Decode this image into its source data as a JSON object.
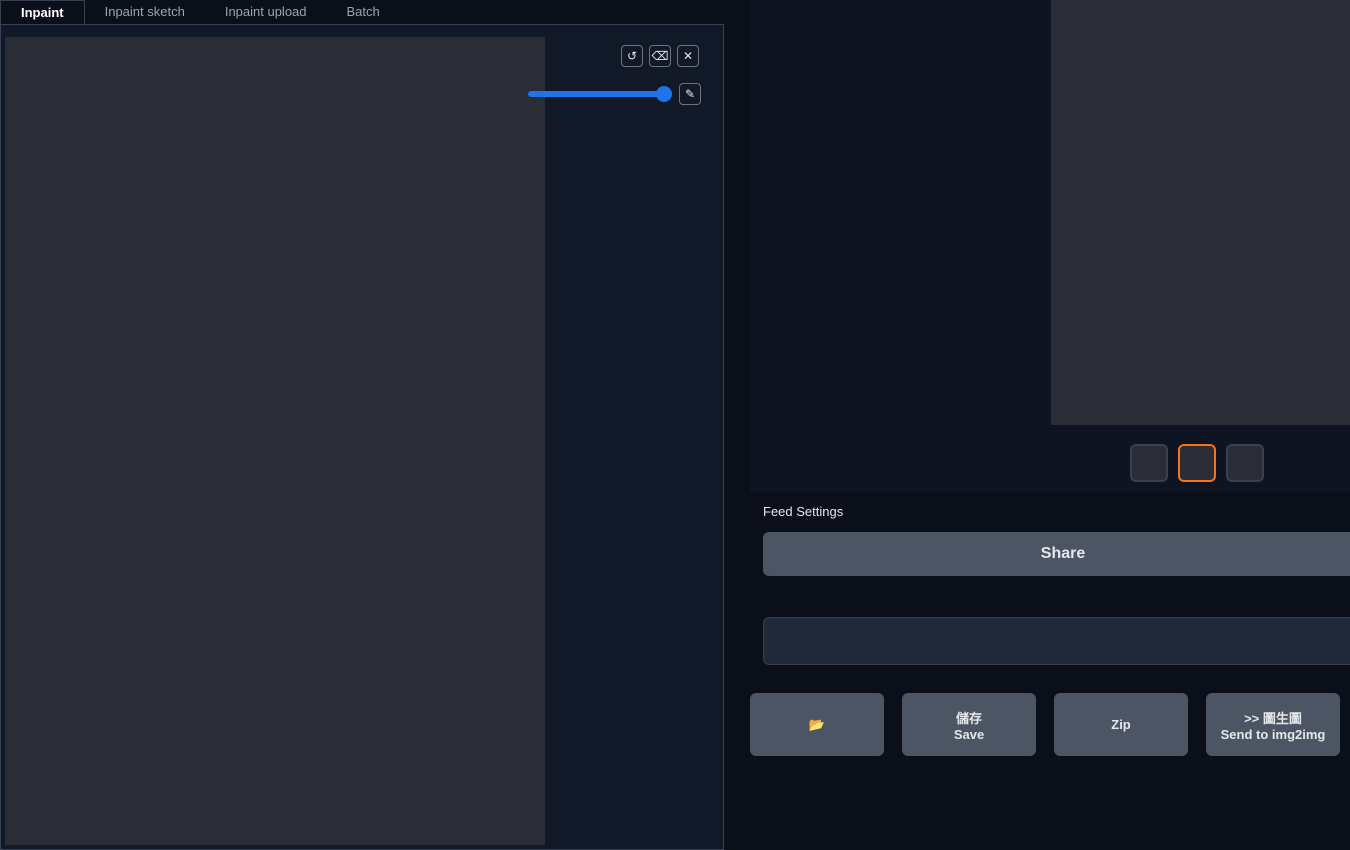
{
  "tabs": [
    {
      "label": "Inpaint"
    },
    {
      "label": "Inpaint sketch"
    },
    {
      "label": "Inpaint upload"
    },
    {
      "label": "Batch"
    }
  ],
  "tools": {
    "undo": "↺",
    "erase": "⌫",
    "close": "✕",
    "brush": "✎"
  },
  "feed_settings": "Feed Settings",
  "share": "Share",
  "buttons": {
    "folder": "📂",
    "save_zh": "儲存",
    "save": "Save",
    "zip": "Zip",
    "send_zh": ">> 圖生圖",
    "send": "Send to img2img"
  }
}
